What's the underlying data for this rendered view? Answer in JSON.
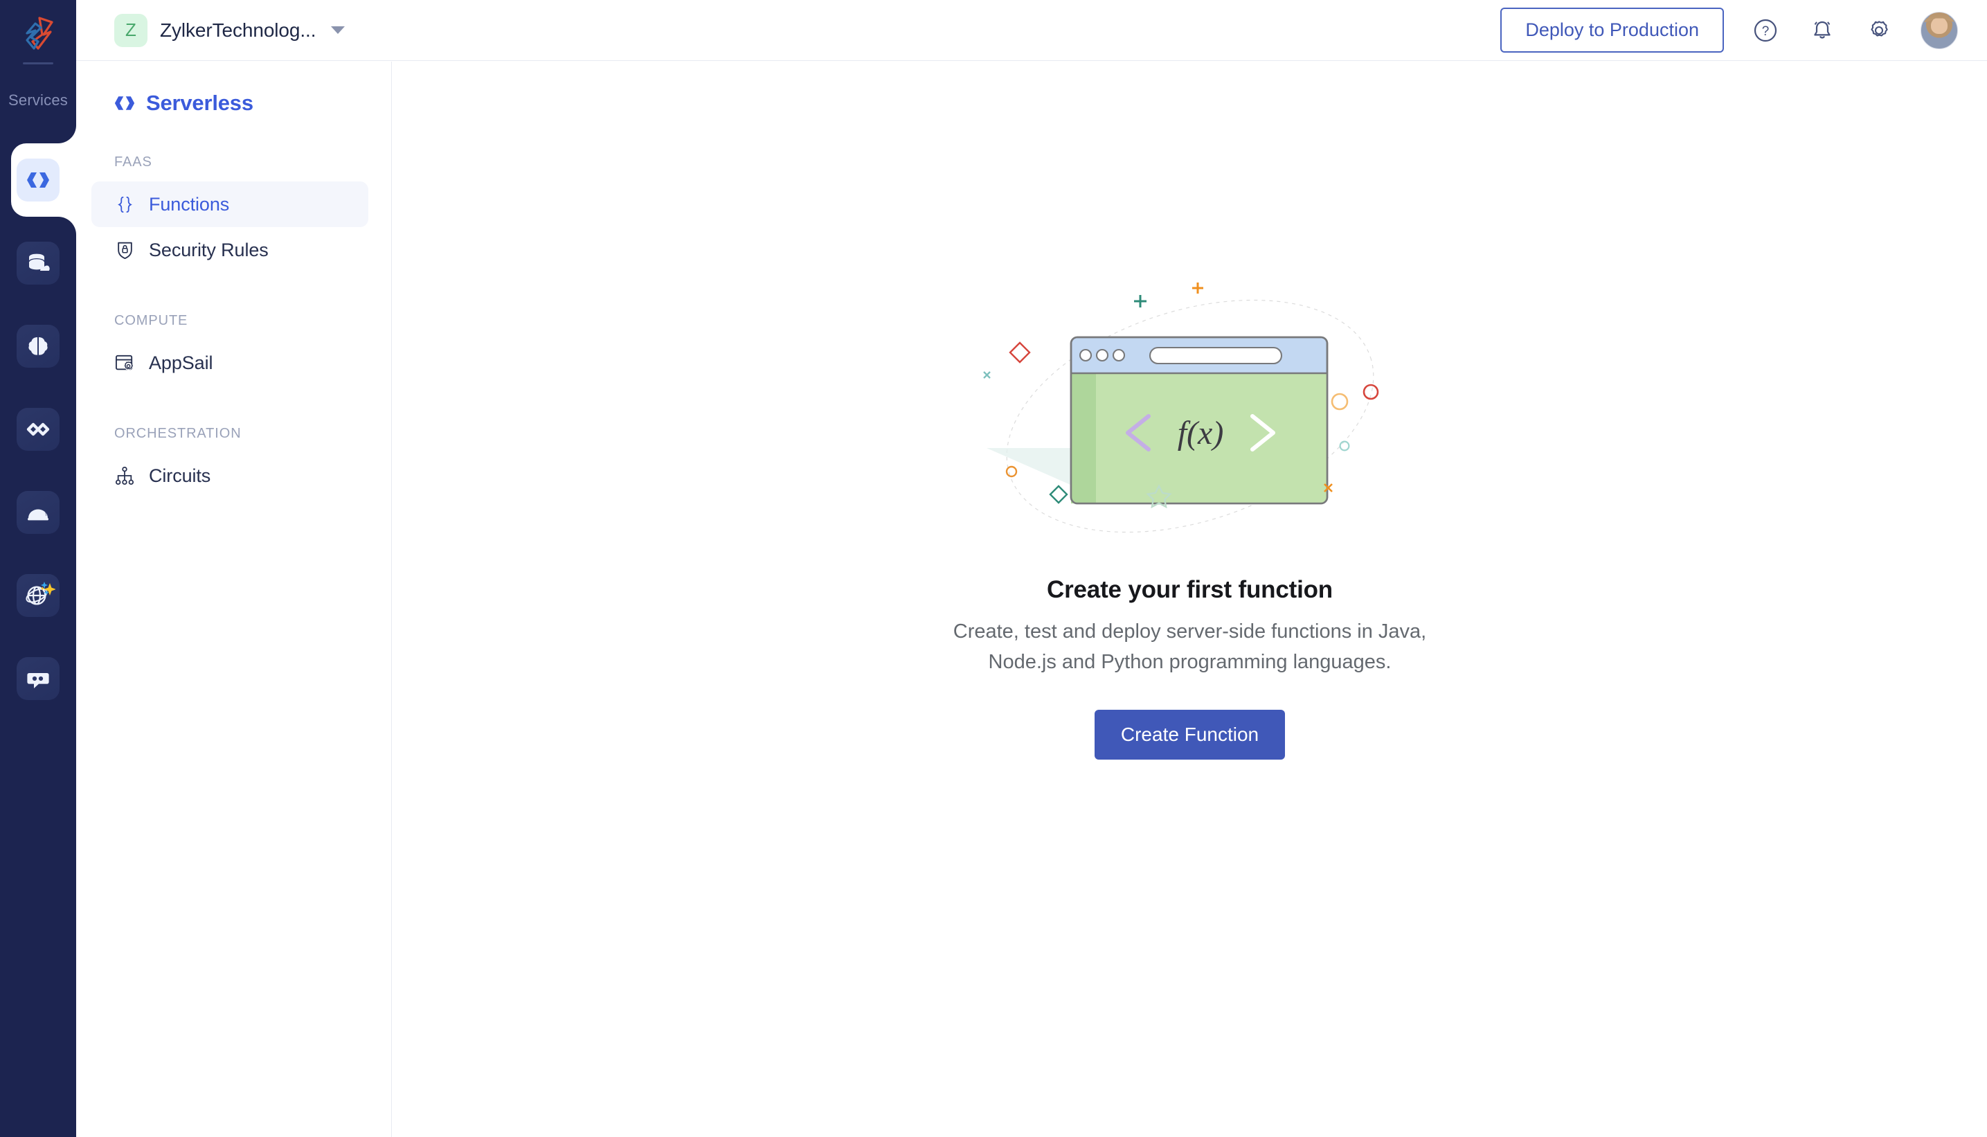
{
  "app": {
    "brand_icon": "zoho-catalyst-logo-icon",
    "rail_label": "Services",
    "colors": {
      "rail_bg": "#1c2450",
      "accent_blue": "#3b5bdb",
      "button_blue": "#4058b8",
      "active_nav_bg": "#f4f6fc",
      "org_avatar_bg": "#d9f5e2",
      "org_avatar_fg": "#49a86c"
    }
  },
  "rail": {
    "label": "Services",
    "items": [
      {
        "name": "serverless",
        "icon": "code-brackets-icon",
        "active": true
      },
      {
        "name": "data-store",
        "icon": "database-cloud-icon",
        "active": false
      },
      {
        "name": "intelligence",
        "icon": "brain-icon",
        "active": false
      },
      {
        "name": "integrations",
        "icon": "infinity-link-icon",
        "active": false
      },
      {
        "name": "devops",
        "icon": "dome-icon",
        "active": false
      },
      {
        "name": "ai-studio",
        "icon": "globe-sparkle-icon",
        "active": false
      },
      {
        "name": "messaging",
        "icon": "chat-bubble-icon",
        "active": false
      }
    ]
  },
  "header": {
    "org_initial": "Z",
    "org_name": "ZylkerTechnolog...",
    "org_caret_icon": "chevron-down-icon",
    "deploy_label": "Deploy to Production",
    "help_icon": "question-circle-icon",
    "notifications_icon": "bell-icon",
    "settings_icon": "gear-icon",
    "avatar_icon": "user-avatar"
  },
  "subnav": {
    "title": "Serverless",
    "title_icon": "code-brackets-icon",
    "groups": [
      {
        "label": "FAAS",
        "items": [
          {
            "label": "Functions",
            "icon": "curly-braces-icon",
            "active": true
          },
          {
            "label": "Security Rules",
            "icon": "shield-lock-icon",
            "active": false
          }
        ]
      },
      {
        "label": "COMPUTE",
        "items": [
          {
            "label": "AppSail",
            "icon": "window-gear-icon",
            "active": false
          }
        ]
      },
      {
        "label": "ORCHESTRATION",
        "items": [
          {
            "label": "Circuits",
            "icon": "hierarchy-nodes-icon",
            "active": false
          }
        ]
      }
    ]
  },
  "main": {
    "illustration": "browser-window-fx-illustration",
    "title": "Create your first function",
    "description": "Create, test and deploy server-side functions in Java, Node.js and Python programming languages.",
    "cta_label": "Create Function"
  }
}
